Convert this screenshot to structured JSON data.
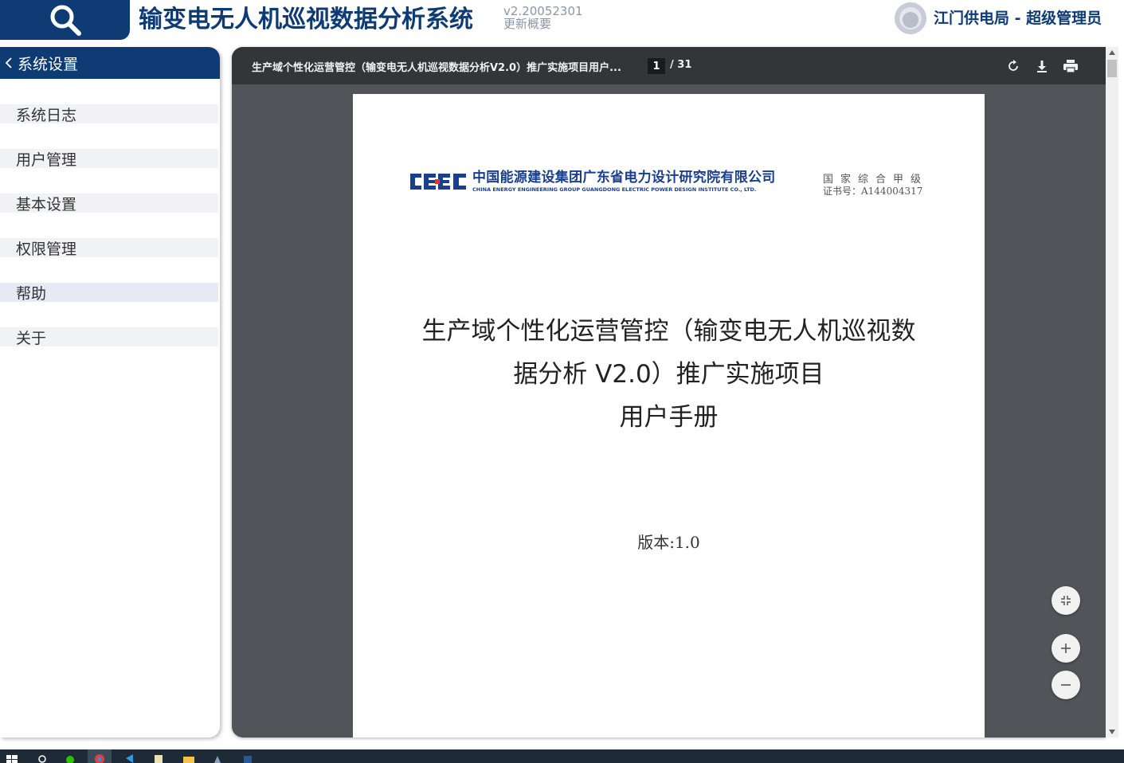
{
  "header": {
    "app_title": "输变电无人机巡视数据分析系统",
    "version": "v2.20052301",
    "update_link": "更新概要",
    "user": "江门供电局 - 超级管理员"
  },
  "sidebar": {
    "section_title": "系统设置",
    "items": [
      {
        "label": "系统日志"
      },
      {
        "label": "用户管理"
      },
      {
        "label": "基本设置"
      },
      {
        "label": "权限管理"
      },
      {
        "label": "帮助",
        "active": true
      },
      {
        "label": "关于"
      }
    ]
  },
  "viewer": {
    "doc_title": "生产域个性化运营管控（输变电无人机巡视数据分析V2.0）推广实施项目用户...",
    "current_page": "1",
    "total_pages": "/ 31",
    "page": {
      "company_cn": "中国能源建设集团广东省电力设计研究院有限公司",
      "company_en": "CHINA ENERGY ENGINEERING GROUP GUANGDONG ELECTRIC POWER DESIGN INSTITUTE CO., LTD.",
      "logo_text": "CEEC",
      "qualification": "国家综合甲级",
      "certificate": "证书号：A144004317",
      "title_line1": "生产域个性化运营管控（输变电无人机巡视数",
      "title_line2": "据分析 V2.0）推广实施项目",
      "title_line3": "用户手册",
      "version": "版本:1.0"
    }
  },
  "colors": {
    "brand": "#0e3b74",
    "viewer_bg": "#515459",
    "toolbar_bg": "#323639"
  }
}
